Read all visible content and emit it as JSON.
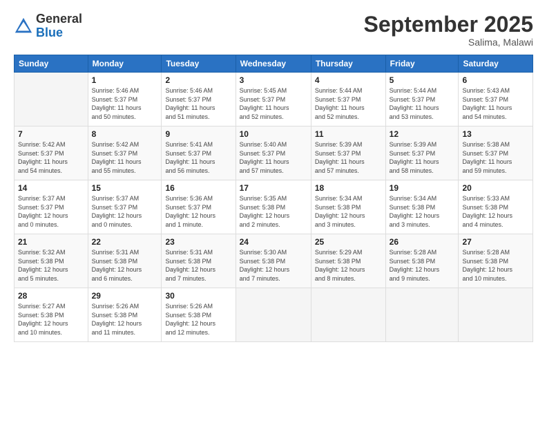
{
  "logo": {
    "general": "General",
    "blue": "Blue"
  },
  "header": {
    "month": "September 2025",
    "location": "Salima, Malawi"
  },
  "weekdays": [
    "Sunday",
    "Monday",
    "Tuesday",
    "Wednesday",
    "Thursday",
    "Friday",
    "Saturday"
  ],
  "weeks": [
    [
      {
        "day": "",
        "info": ""
      },
      {
        "day": "1",
        "info": "Sunrise: 5:46 AM\nSunset: 5:37 PM\nDaylight: 11 hours\nand 50 minutes."
      },
      {
        "day": "2",
        "info": "Sunrise: 5:46 AM\nSunset: 5:37 PM\nDaylight: 11 hours\nand 51 minutes."
      },
      {
        "day": "3",
        "info": "Sunrise: 5:45 AM\nSunset: 5:37 PM\nDaylight: 11 hours\nand 52 minutes."
      },
      {
        "day": "4",
        "info": "Sunrise: 5:44 AM\nSunset: 5:37 PM\nDaylight: 11 hours\nand 52 minutes."
      },
      {
        "day": "5",
        "info": "Sunrise: 5:44 AM\nSunset: 5:37 PM\nDaylight: 11 hours\nand 53 minutes."
      },
      {
        "day": "6",
        "info": "Sunrise: 5:43 AM\nSunset: 5:37 PM\nDaylight: 11 hours\nand 54 minutes."
      }
    ],
    [
      {
        "day": "7",
        "info": "Sunrise: 5:42 AM\nSunset: 5:37 PM\nDaylight: 11 hours\nand 54 minutes."
      },
      {
        "day": "8",
        "info": "Sunrise: 5:42 AM\nSunset: 5:37 PM\nDaylight: 11 hours\nand 55 minutes."
      },
      {
        "day": "9",
        "info": "Sunrise: 5:41 AM\nSunset: 5:37 PM\nDaylight: 11 hours\nand 56 minutes."
      },
      {
        "day": "10",
        "info": "Sunrise: 5:40 AM\nSunset: 5:37 PM\nDaylight: 11 hours\nand 57 minutes."
      },
      {
        "day": "11",
        "info": "Sunrise: 5:39 AM\nSunset: 5:37 PM\nDaylight: 11 hours\nand 57 minutes."
      },
      {
        "day": "12",
        "info": "Sunrise: 5:39 AM\nSunset: 5:37 PM\nDaylight: 11 hours\nand 58 minutes."
      },
      {
        "day": "13",
        "info": "Sunrise: 5:38 AM\nSunset: 5:37 PM\nDaylight: 11 hours\nand 59 minutes."
      }
    ],
    [
      {
        "day": "14",
        "info": "Sunrise: 5:37 AM\nSunset: 5:37 PM\nDaylight: 12 hours\nand 0 minutes."
      },
      {
        "day": "15",
        "info": "Sunrise: 5:37 AM\nSunset: 5:37 PM\nDaylight: 12 hours\nand 0 minutes."
      },
      {
        "day": "16",
        "info": "Sunrise: 5:36 AM\nSunset: 5:37 PM\nDaylight: 12 hours\nand 1 minute."
      },
      {
        "day": "17",
        "info": "Sunrise: 5:35 AM\nSunset: 5:38 PM\nDaylight: 12 hours\nand 2 minutes."
      },
      {
        "day": "18",
        "info": "Sunrise: 5:34 AM\nSunset: 5:38 PM\nDaylight: 12 hours\nand 3 minutes."
      },
      {
        "day": "19",
        "info": "Sunrise: 5:34 AM\nSunset: 5:38 PM\nDaylight: 12 hours\nand 3 minutes."
      },
      {
        "day": "20",
        "info": "Sunrise: 5:33 AM\nSunset: 5:38 PM\nDaylight: 12 hours\nand 4 minutes."
      }
    ],
    [
      {
        "day": "21",
        "info": "Sunrise: 5:32 AM\nSunset: 5:38 PM\nDaylight: 12 hours\nand 5 minutes."
      },
      {
        "day": "22",
        "info": "Sunrise: 5:31 AM\nSunset: 5:38 PM\nDaylight: 12 hours\nand 6 minutes."
      },
      {
        "day": "23",
        "info": "Sunrise: 5:31 AM\nSunset: 5:38 PM\nDaylight: 12 hours\nand 7 minutes."
      },
      {
        "day": "24",
        "info": "Sunrise: 5:30 AM\nSunset: 5:38 PM\nDaylight: 12 hours\nand 7 minutes."
      },
      {
        "day": "25",
        "info": "Sunrise: 5:29 AM\nSunset: 5:38 PM\nDaylight: 12 hours\nand 8 minutes."
      },
      {
        "day": "26",
        "info": "Sunrise: 5:28 AM\nSunset: 5:38 PM\nDaylight: 12 hours\nand 9 minutes."
      },
      {
        "day": "27",
        "info": "Sunrise: 5:28 AM\nSunset: 5:38 PM\nDaylight: 12 hours\nand 10 minutes."
      }
    ],
    [
      {
        "day": "28",
        "info": "Sunrise: 5:27 AM\nSunset: 5:38 PM\nDaylight: 12 hours\nand 10 minutes."
      },
      {
        "day": "29",
        "info": "Sunrise: 5:26 AM\nSunset: 5:38 PM\nDaylight: 12 hours\nand 11 minutes."
      },
      {
        "day": "30",
        "info": "Sunrise: 5:26 AM\nSunset: 5:38 PM\nDaylight: 12 hours\nand 12 minutes."
      },
      {
        "day": "",
        "info": ""
      },
      {
        "day": "",
        "info": ""
      },
      {
        "day": "",
        "info": ""
      },
      {
        "day": "",
        "info": ""
      }
    ]
  ]
}
